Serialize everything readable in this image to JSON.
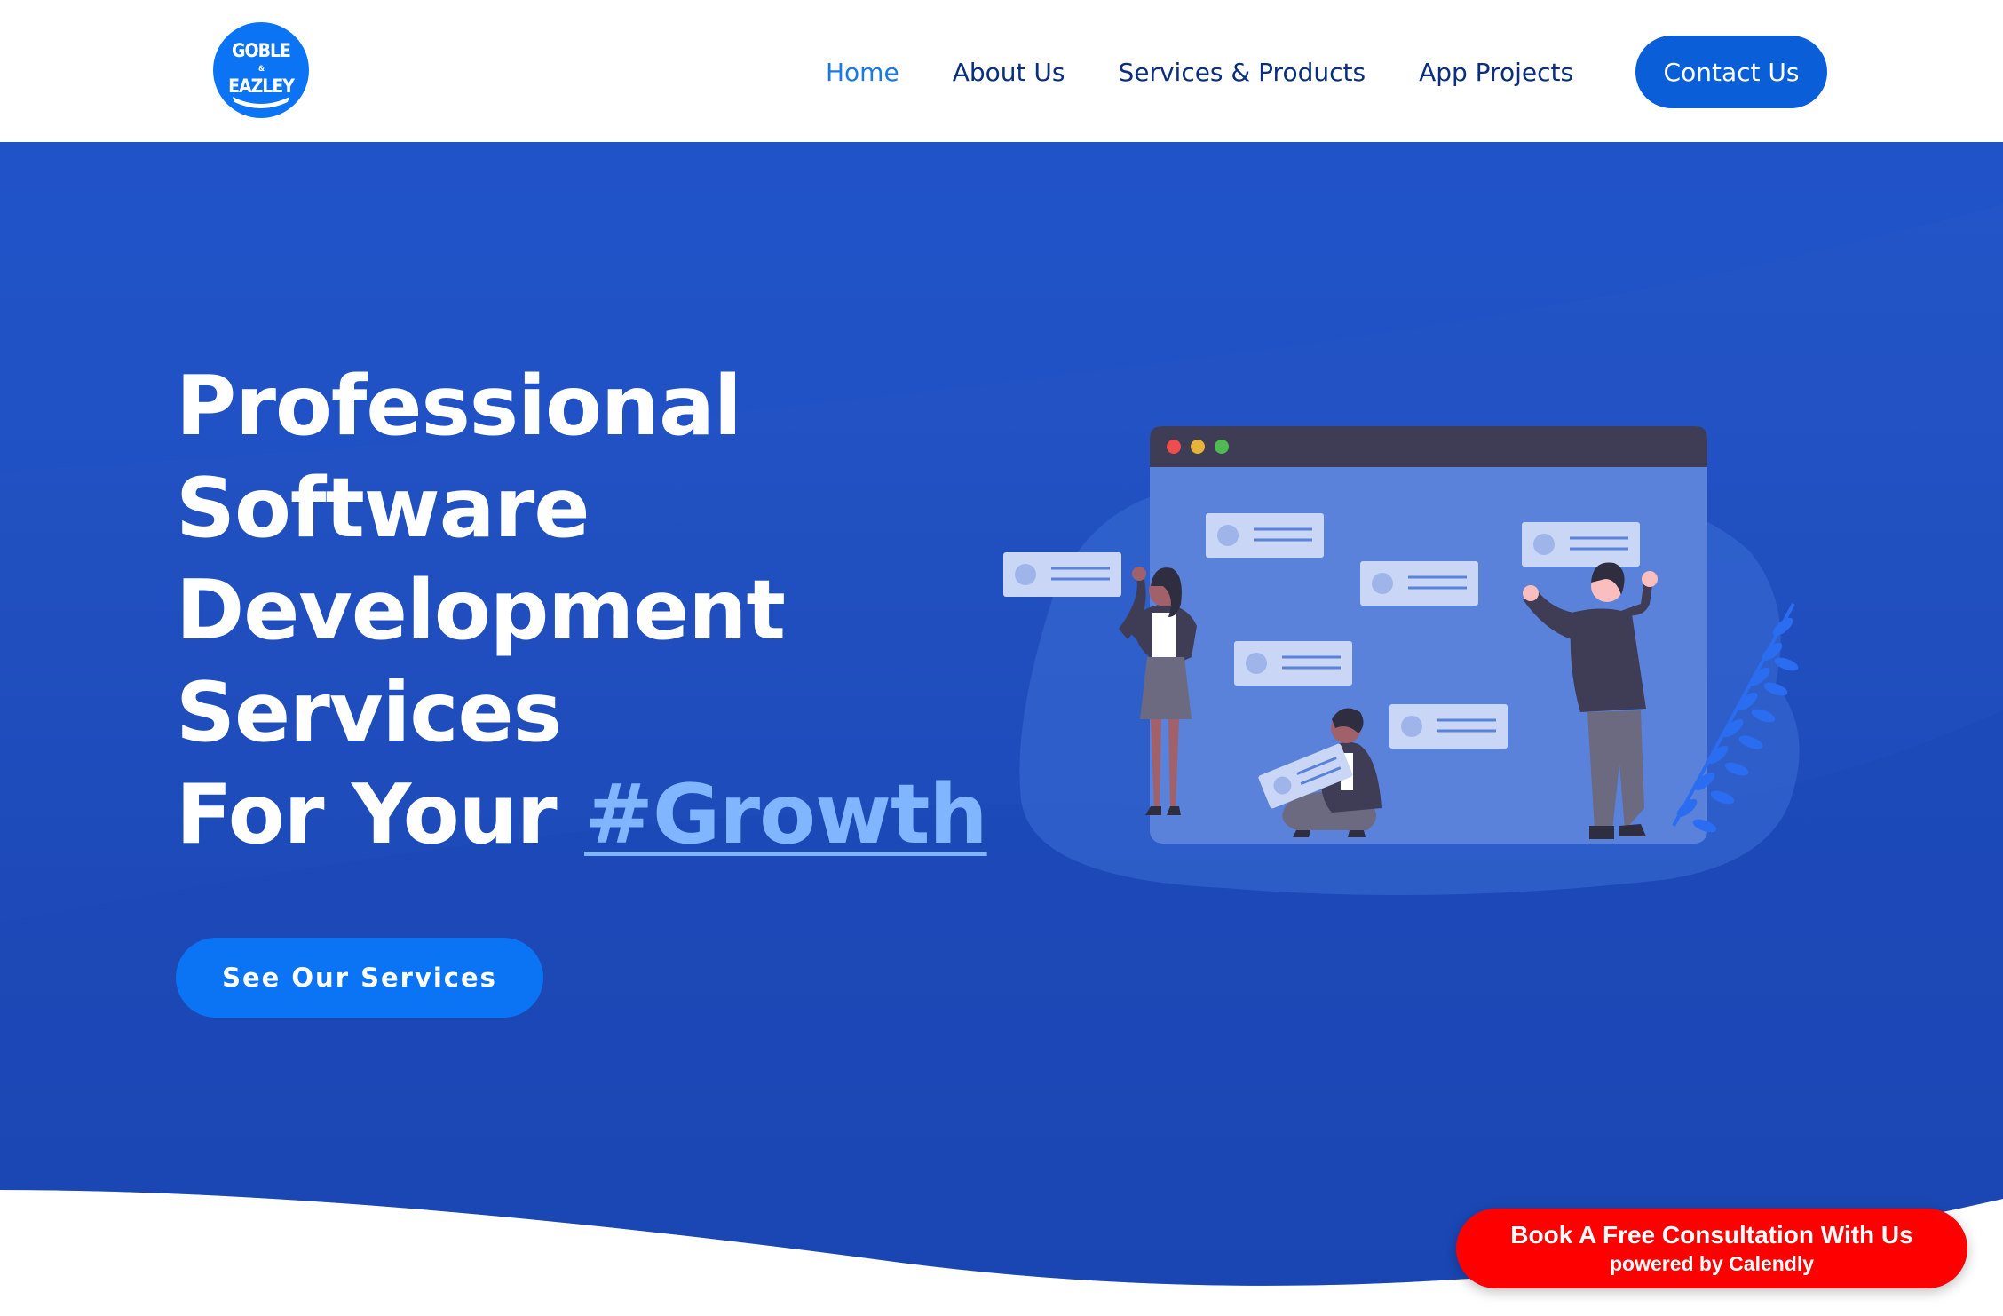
{
  "brand": {
    "logo_line1": "GOBLE",
    "logo_amp": "&",
    "logo_line2": "EAZLEY",
    "logo_color": "#0b74f5"
  },
  "nav": {
    "items": [
      {
        "label": "Home",
        "active": true
      },
      {
        "label": "About Us",
        "active": false
      },
      {
        "label": "Services & Products",
        "active": false
      },
      {
        "label": "App Projects",
        "active": false
      }
    ],
    "cta_label": "Contact Us"
  },
  "hero": {
    "headline_lines": [
      "Professional",
      "Software",
      "Development",
      "Services"
    ],
    "headline_last_prefix": "For Your ",
    "headline_accent": "#Growth",
    "cta_label": "See Our Services",
    "colors": {
      "background": "#1c4fc1",
      "accent_text": "#7fb6ff",
      "button": "#0b74f5"
    }
  },
  "calendly": {
    "label": "Book A Free Consultation With Us",
    "sublabel": "powered by Calendly",
    "color": "#ff0000"
  },
  "icons": [
    "logo-emblem",
    "illustration-collaboration"
  ]
}
